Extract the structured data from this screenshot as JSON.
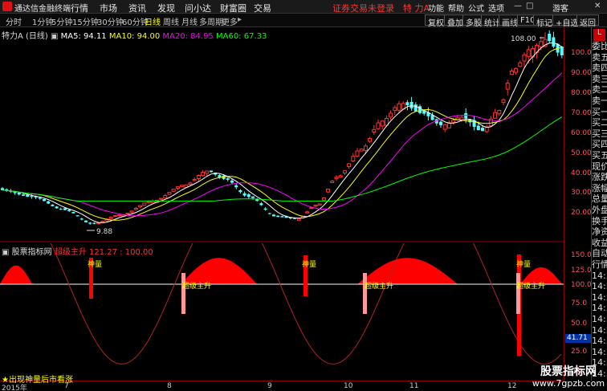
{
  "app": {
    "name": "通达信金融终端",
    "menus": [
      "行情",
      "市场",
      "资讯",
      "发现",
      "问小达",
      "财富圈",
      "交易"
    ],
    "notice": "证券交易未登录",
    "stock_title": "特 力A",
    "right_menus": [
      "功能",
      "帮助",
      "公式",
      "选项",
      "游客"
    ],
    "window_buttons": [
      "—",
      "□",
      "✕"
    ]
  },
  "periods": [
    "分时",
    "1分钟",
    "5分钟",
    "15分钟",
    "30分钟",
    "60分钟",
    "日线",
    "周线",
    "月线",
    "多周期",
    "更多"
  ],
  "active_period": "日线",
  "tools": [
    "复权",
    "叠加",
    "多股",
    "统计",
    "画线",
    "F10",
    "标记",
    "+自选",
    "返回"
  ],
  "main_info": {
    "name": "特力A (日线)",
    "ma5": "MA5: 94.11",
    "ma10": "MA10: 94.00",
    "ma20": "MA20: 84.95",
    "ma60": "MA60: 67.33"
  },
  "indicator_info": {
    "name": "股票指标网",
    "label": "超级主升",
    "values": "121.27 : 100.00"
  },
  "chart_labels": {
    "high": "108.00",
    "low": "9.88",
    "signal_a": "神量",
    "signal_b": "超级主升"
  },
  "price_axis": [
    "100.00",
    "90.00",
    "80.00",
    "70.00",
    "60.00",
    "50.00",
    "40.00",
    "30.00",
    "20.00"
  ],
  "indicator_axis": [
    "150.0",
    "125.0",
    "100.0",
    "75.0",
    "50.0",
    "25.0",
    "0.0"
  ],
  "indicator_current": "41.71",
  "date_axis": [
    "2015年",
    "7",
    "8",
    "9",
    "10",
    "11",
    "12"
  ],
  "side_panel": {
    "badge": "L",
    "items": [
      "委比",
      "卖五",
      "卖四",
      "卖三",
      "卖二",
      "卖一",
      "买一",
      "买二",
      "买三",
      "买四",
      "买五",
      "现价",
      "涨跌",
      "涨幅",
      "总量",
      "外盘",
      "换手",
      "净资",
      "收益",
      "自动",
      "行情",
      "14:56",
      "14:56",
      "14:56",
      "14:56",
      "14:56",
      "14:56",
      "14:56",
      "14:56",
      "14:56",
      "14:56"
    ]
  },
  "hint": "★出现神量后市看涨",
  "watermark": {
    "line1": "股票指标网",
    "line2": "www.7gpzb.com"
  },
  "colors": {
    "up": "#ff3333",
    "down": "#54ffff",
    "ma5": "#ffffff",
    "ma10": "#ffff00",
    "ma20": "#ff00ff",
    "ma60": "#00ff00"
  },
  "chart_data": {
    "type": "candlestick",
    "ylim": [
      0,
      110
    ],
    "ma5_last": 94.11,
    "ma10_last": 94.0,
    "ma20_last": 84.95,
    "ma60_last": 67.33,
    "high_marker": 108.0,
    "low_marker": 9.88
  }
}
